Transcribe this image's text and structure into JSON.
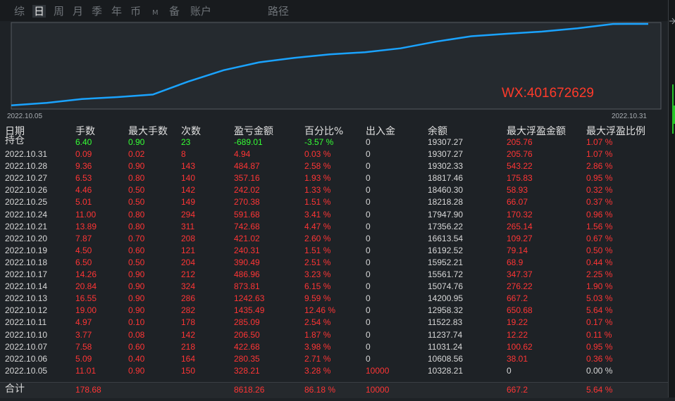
{
  "tabs": [
    {
      "label": "综",
      "active": false
    },
    {
      "label": "日",
      "active": true
    },
    {
      "label": "周",
      "active": false
    },
    {
      "label": "月",
      "active": false
    },
    {
      "label": "季",
      "active": false
    },
    {
      "label": "年",
      "active": false
    },
    {
      "label": "币",
      "active": false
    },
    {
      "label": "M",
      "active": false
    },
    {
      "label": "备",
      "active": false
    },
    {
      "label": "账户",
      "active": false
    },
    {
      "label": "路径",
      "active": false
    }
  ],
  "chart_data": {
    "type": "line",
    "x_start_label": "2022.10.05",
    "x_end_label": "2022.10.31",
    "x": [
      "2022.10.05",
      "2022.10.06",
      "2022.10.07",
      "2022.10.10",
      "2022.10.11",
      "2022.10.12",
      "2022.10.13",
      "2022.10.14",
      "2022.10.17",
      "2022.10.18",
      "2022.10.19",
      "2022.10.20",
      "2022.10.21",
      "2022.10.24",
      "2022.10.25",
      "2022.10.26",
      "2022.10.27",
      "2022.10.28",
      "2022.10.31"
    ],
    "values": [
      10328.21,
      10608.56,
      11031.24,
      11237.74,
      11522.83,
      12958.32,
      14200.95,
      15074.76,
      15561.72,
      15952.21,
      16192.52,
      16613.54,
      17356.22,
      17947.9,
      18218.28,
      18460.3,
      18817.46,
      19302.33,
      19307.27
    ],
    "line_color": "#1aa3ff",
    "watermark": "WX:401672629",
    "watermark_color": "#ff3a2a"
  },
  "table": {
    "headers": [
      "日期",
      "手数",
      "最大手数",
      "次数",
      "盈亏金额",
      "百分比%",
      "出入金",
      "余额",
      "最大浮盈金额",
      "最大浮盈比例"
    ],
    "position_row": {
      "label": "持仓",
      "lots": "6.40",
      "max_lots": "0.90",
      "count": "23",
      "pnl": "-689.01",
      "pct": "-3.57 %",
      "flow": "0",
      "balance": "19307.27",
      "max_float": "205.76",
      "max_float_pct": "1.07 %"
    },
    "rows": [
      {
        "date": "2022.10.31",
        "lots": "0.09",
        "max_lots": "0.02",
        "count": "8",
        "pnl": "4.94",
        "pct": "0.03 %",
        "flow": "0",
        "balance": "19307.27",
        "max_float": "205.76",
        "max_float_pct": "1.07 %"
      },
      {
        "date": "2022.10.28",
        "lots": "9.36",
        "max_lots": "0.90",
        "count": "143",
        "pnl": "484.87",
        "pct": "2.58 %",
        "flow": "0",
        "balance": "19302.33",
        "max_float": "543.22",
        "max_float_pct": "2.86 %"
      },
      {
        "date": "2022.10.27",
        "lots": "6.53",
        "max_lots": "0.80",
        "count": "140",
        "pnl": "357.16",
        "pct": "1.93 %",
        "flow": "0",
        "balance": "18817.46",
        "max_float": "175.83",
        "max_float_pct": "0.95 %"
      },
      {
        "date": "2022.10.26",
        "lots": "4.46",
        "max_lots": "0.50",
        "count": "142",
        "pnl": "242.02",
        "pct": "1.33 %",
        "flow": "0",
        "balance": "18460.30",
        "max_float": "58.93",
        "max_float_pct": "0.32 %"
      },
      {
        "date": "2022.10.25",
        "lots": "5.01",
        "max_lots": "0.50",
        "count": "149",
        "pnl": "270.38",
        "pct": "1.51 %",
        "flow": "0",
        "balance": "18218.28",
        "max_float": "66.07",
        "max_float_pct": "0.37 %"
      },
      {
        "date": "2022.10.24",
        "lots": "11.00",
        "max_lots": "0.80",
        "count": "294",
        "pnl": "591.68",
        "pct": "3.41 %",
        "flow": "0",
        "balance": "17947.90",
        "max_float": "170.32",
        "max_float_pct": "0.96 %"
      },
      {
        "date": "2022.10.21",
        "lots": "13.89",
        "max_lots": "0.80",
        "count": "311",
        "pnl": "742.68",
        "pct": "4.47 %",
        "flow": "0",
        "balance": "17356.22",
        "max_float": "265.14",
        "max_float_pct": "1.56 %"
      },
      {
        "date": "2022.10.20",
        "lots": "7.87",
        "max_lots": "0.70",
        "count": "208",
        "pnl": "421.02",
        "pct": "2.60 %",
        "flow": "0",
        "balance": "16613.54",
        "max_float": "109.27",
        "max_float_pct": "0.67 %"
      },
      {
        "date": "2022.10.19",
        "lots": "4.50",
        "max_lots": "0.60",
        "count": "121",
        "pnl": "240.31",
        "pct": "1.51 %",
        "flow": "0",
        "balance": "16192.52",
        "max_float": "79.14",
        "max_float_pct": "0.50 %"
      },
      {
        "date": "2022.10.18",
        "lots": "6.50",
        "max_lots": "0.50",
        "count": "204",
        "pnl": "390.49",
        "pct": "2.51 %",
        "flow": "0",
        "balance": "15952.21",
        "max_float": "68.9",
        "max_float_pct": "0.44 %"
      },
      {
        "date": "2022.10.17",
        "lots": "14.26",
        "max_lots": "0.90",
        "count": "212",
        "pnl": "486.96",
        "pct": "3.23 %",
        "flow": "0",
        "balance": "15561.72",
        "max_float": "347.37",
        "max_float_pct": "2.25 %"
      },
      {
        "date": "2022.10.14",
        "lots": "20.84",
        "max_lots": "0.90",
        "count": "324",
        "pnl": "873.81",
        "pct": "6.15 %",
        "flow": "0",
        "balance": "15074.76",
        "max_float": "276.22",
        "max_float_pct": "1.90 %"
      },
      {
        "date": "2022.10.13",
        "lots": "16.55",
        "max_lots": "0.90",
        "count": "286",
        "pnl": "1242.63",
        "pct": "9.59 %",
        "flow": "0",
        "balance": "14200.95",
        "max_float": "667.2",
        "max_float_pct": "5.03 %"
      },
      {
        "date": "2022.10.12",
        "lots": "19.00",
        "max_lots": "0.90",
        "count": "282",
        "pnl": "1435.49",
        "pct": "12.46 %",
        "flow": "0",
        "balance": "12958.32",
        "max_float": "650.68",
        "max_float_pct": "5.64 %"
      },
      {
        "date": "2022.10.11",
        "lots": "4.97",
        "max_lots": "0.10",
        "count": "178",
        "pnl": "285.09",
        "pct": "2.54 %",
        "flow": "0",
        "balance": "11522.83",
        "max_float": "19.22",
        "max_float_pct": "0.17 %"
      },
      {
        "date": "2022.10.10",
        "lots": "3.77",
        "max_lots": "0.08",
        "count": "142",
        "pnl": "206.50",
        "pct": "1.87 %",
        "flow": "0",
        "balance": "11237.74",
        "max_float": "12.22",
        "max_float_pct": "0.11 %"
      },
      {
        "date": "2022.10.07",
        "lots": "7.58",
        "max_lots": "0.60",
        "count": "218",
        "pnl": "422.68",
        "pct": "3.98 %",
        "flow": "0",
        "balance": "11031.24",
        "max_float": "100.62",
        "max_float_pct": "0.95 %"
      },
      {
        "date": "2022.10.06",
        "lots": "5.09",
        "max_lots": "0.40",
        "count": "164",
        "pnl": "280.35",
        "pct": "2.71 %",
        "flow": "0",
        "balance": "10608.56",
        "max_float": "38.01",
        "max_float_pct": "0.36 %"
      },
      {
        "date": "2022.10.05",
        "lots": "11.01",
        "max_lots": "0.90",
        "count": "150",
        "pnl": "328.21",
        "pct": "3.28 %",
        "flow": "10000",
        "balance": "10328.21",
        "max_float": "0",
        "max_float_pct": "0.00 %"
      }
    ],
    "footer": {
      "label": "合计",
      "lots": "178.68",
      "pnl": "8618.26",
      "pct": "86.18 %",
      "flow": "10000",
      "max_float": "667.2",
      "max_float_pct": "5.64 %"
    }
  }
}
